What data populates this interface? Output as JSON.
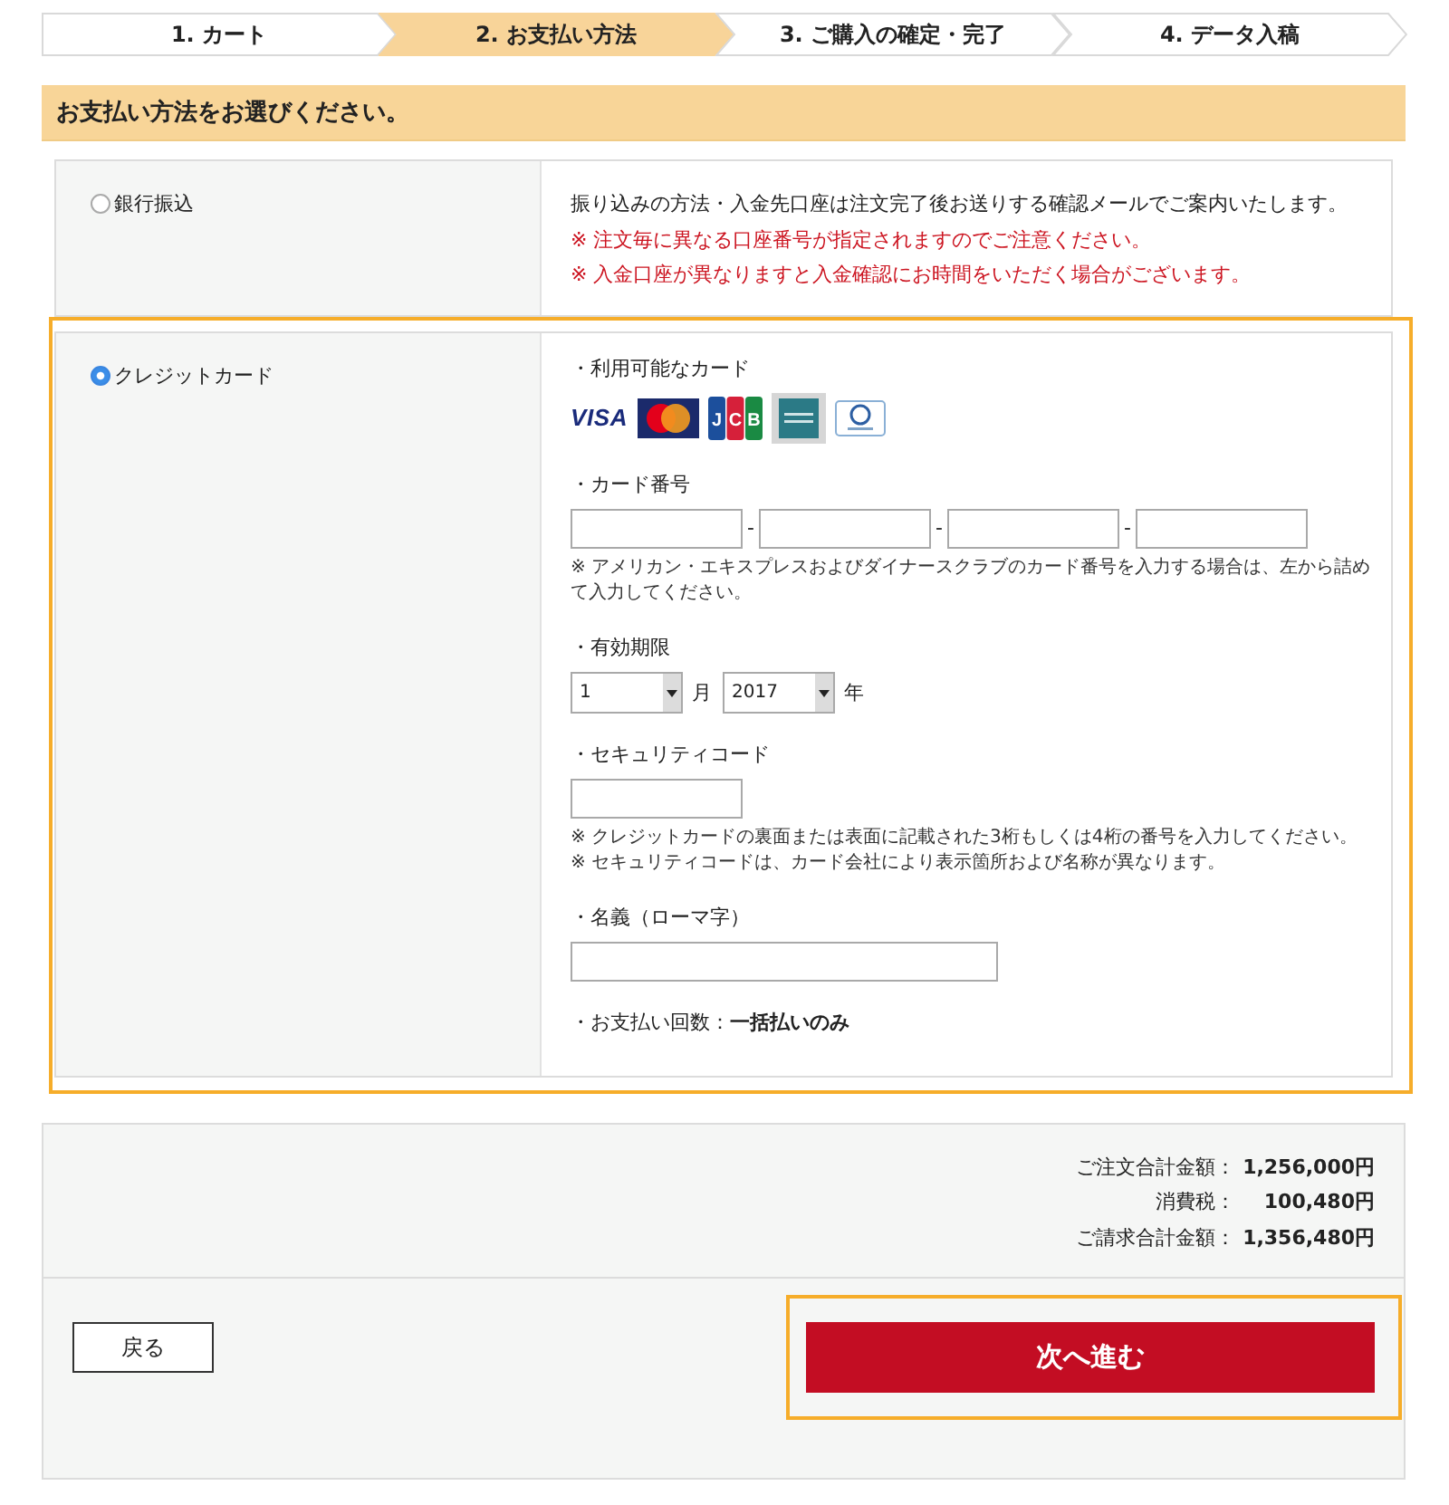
{
  "steps": [
    {
      "label": "1. カート",
      "selected": false
    },
    {
      "label": "2. お支払い方法",
      "selected": true
    },
    {
      "label": "3. ご購入の確定・完了",
      "selected": false
    },
    {
      "label": "4. データ入稿",
      "selected": false
    }
  ],
  "section": {
    "title": "お支払い方法をお選びください。"
  },
  "payment_options": [
    {
      "kind": "bank",
      "label": "銀行振込",
      "selected": false,
      "highlighted": false,
      "notes": [
        {
          "text": "振り込みの方法・入金先口座は注文完了後お送りする確認メールでご案内いたします。",
          "warning": false
        },
        {
          "text": "※ 注文毎に異なる口座番号が指定されますのでご注意ください。",
          "warning": true
        },
        {
          "text": "※ 入金口座が異なりますと入金確認にお時間をいただく場合がございます。",
          "warning": true
        }
      ]
    },
    {
      "kind": "card",
      "label": "クレジットカード",
      "selected": true,
      "highlighted": true,
      "fields": [
        {
          "kind": "logos",
          "label": "・利用可能なカード",
          "logos": [
            {
              "kind": "wordmark",
              "text": "VISA"
            },
            {
              "kind": "circles"
            },
            {
              "kind": "panels",
              "text": "JCB"
            },
            {
              "kind": "square"
            },
            {
              "kind": "roundel"
            }
          ]
        },
        {
          "kind": "card_number",
          "label": "・カード番号",
          "parts": [
            {
              "kind": "input"
            },
            {
              "kind": "separator",
              "text": "-"
            },
            {
              "kind": "input"
            },
            {
              "kind": "separator",
              "text": "-"
            },
            {
              "kind": "input"
            },
            {
              "kind": "separator",
              "text": "-"
            },
            {
              "kind": "input"
            }
          ],
          "notes": [
            "※ アメリカン・エキスプレスおよびダイナースクラブのカード番号を入力する場合は、左から詰めて入力してください。"
          ]
        },
        {
          "kind": "expiry",
          "label": "・有効期限",
          "parts": [
            {
              "kind": "select",
              "value": "1"
            },
            {
              "kind": "unit",
              "text": "月"
            },
            {
              "kind": "select",
              "value": "2017"
            },
            {
              "kind": "unit",
              "text": "年"
            }
          ]
        },
        {
          "kind": "code_input",
          "label": "・セキュリティコード",
          "notes": [
            "※ クレジットカードの裏面または表面に記載された3桁もしくは4桁の番号を入力してください。",
            "※ セキュリティコードは、カード会社により表示箇所および名称が異なります。"
          ]
        },
        {
          "kind": "name_input",
          "label": "・名義（ローマ字）"
        },
        {
          "kind": "summary",
          "text": "・お支払い回数：**一括払いのみ**"
        }
      ]
    }
  ],
  "totals": [
    {
      "label": "ご注文合計金額：",
      "value": "1,256,000円"
    },
    {
      "label": "消費税：",
      "value": "100,480円"
    },
    {
      "label": "ご請求合計金額：",
      "value": "1,356,480円"
    }
  ],
  "buttons": [
    {
      "kind": "back",
      "label": "戻る",
      "highlighted": false
    },
    {
      "kind": "next",
      "label": "次へ進む",
      "highlighted": true
    }
  ]
}
